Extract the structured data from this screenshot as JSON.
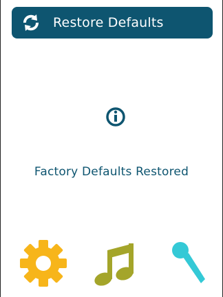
{
  "header": {
    "title": "Restore Defaults",
    "icon": "refresh-icon",
    "background_color": "#0e5570"
  },
  "status": {
    "icon": "info-icon",
    "message": "Factory Defaults Restored",
    "color": "#0e5570"
  },
  "bottom_nav": [
    {
      "icon": "gear-icon",
      "color": "#f7b51a"
    },
    {
      "icon": "music-note-icon",
      "color": "#a4a52a"
    },
    {
      "icon": "microphone-icon",
      "color": "#34c9d6"
    }
  ]
}
